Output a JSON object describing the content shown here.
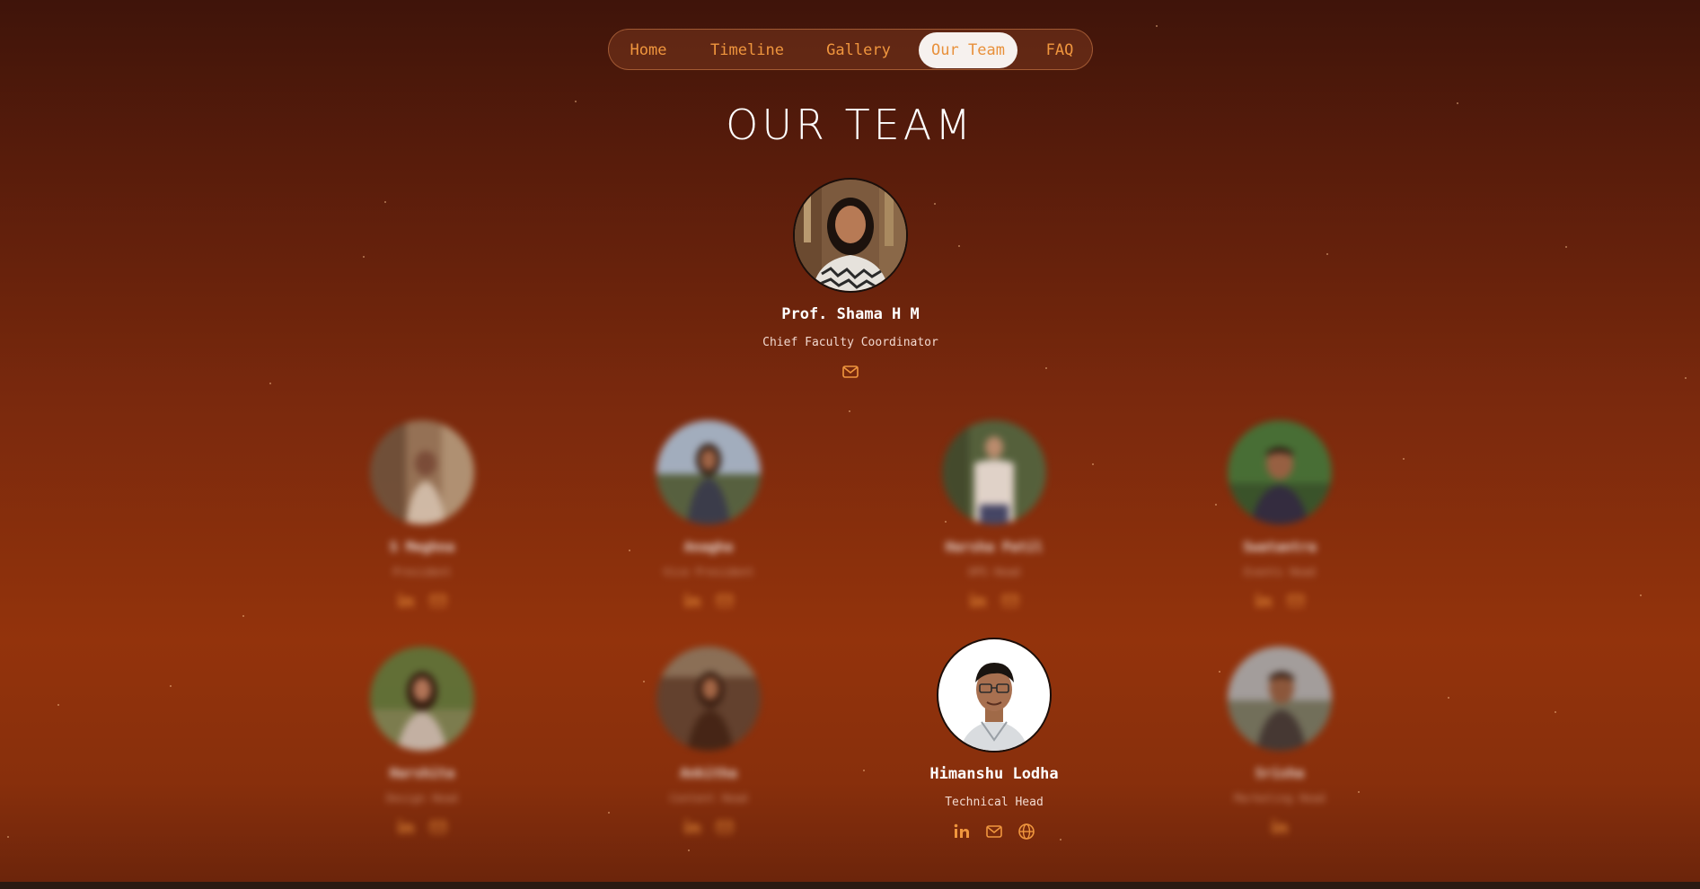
{
  "nav": {
    "items": [
      {
        "label": "Home",
        "active": false
      },
      {
        "label": "Timeline",
        "active": false
      },
      {
        "label": "Gallery",
        "active": false
      },
      {
        "label": "Our Team",
        "active": true
      },
      {
        "label": "FAQ",
        "active": false
      }
    ]
  },
  "page": {
    "title": "OUR TEAM"
  },
  "coordinator": {
    "name": "Prof. Shama H M",
    "role": "Chief Faculty Coordinator",
    "socials": [
      "mail-icon"
    ]
  },
  "team": [
    {
      "name": "S Meghna",
      "role": "President",
      "socials": [
        "linkedin-icon",
        "mail-icon"
      ],
      "focused": false
    },
    {
      "name": "Anagha",
      "role": "Vice President",
      "socials": [
        "linkedin-icon",
        "mail-icon"
      ],
      "focused": false
    },
    {
      "name": "Harsha Patil",
      "role": "OPS Head",
      "socials": [
        "linkedin-icon",
        "mail-icon"
      ],
      "focused": false
    },
    {
      "name": "Swatantra",
      "role": "Events Head",
      "socials": [
        "linkedin-icon",
        "mail-icon"
      ],
      "focused": false
    },
    {
      "name": "Harshita",
      "role": "Design Head",
      "socials": [
        "linkedin-icon",
        "mail-icon"
      ],
      "focused": false
    },
    {
      "name": "Ankitha",
      "role": "Content Head",
      "socials": [
        "linkedin-icon",
        "mail-icon"
      ],
      "focused": false
    },
    {
      "name": "Himanshu Lodha",
      "role": "Technical Head",
      "socials": [
        "linkedin-icon",
        "mail-icon",
        "globe-icon"
      ],
      "focused": true
    },
    {
      "name": "Srisha",
      "role": "Marketing Head",
      "socials": [
        "linkedin-icon"
      ],
      "focused": false
    }
  ],
  "colors": {
    "accent": "#f0963e",
    "nav_active_bg": "#f6f1ee",
    "bg_top": "#3f140a",
    "bg_mid": "#93330c"
  }
}
